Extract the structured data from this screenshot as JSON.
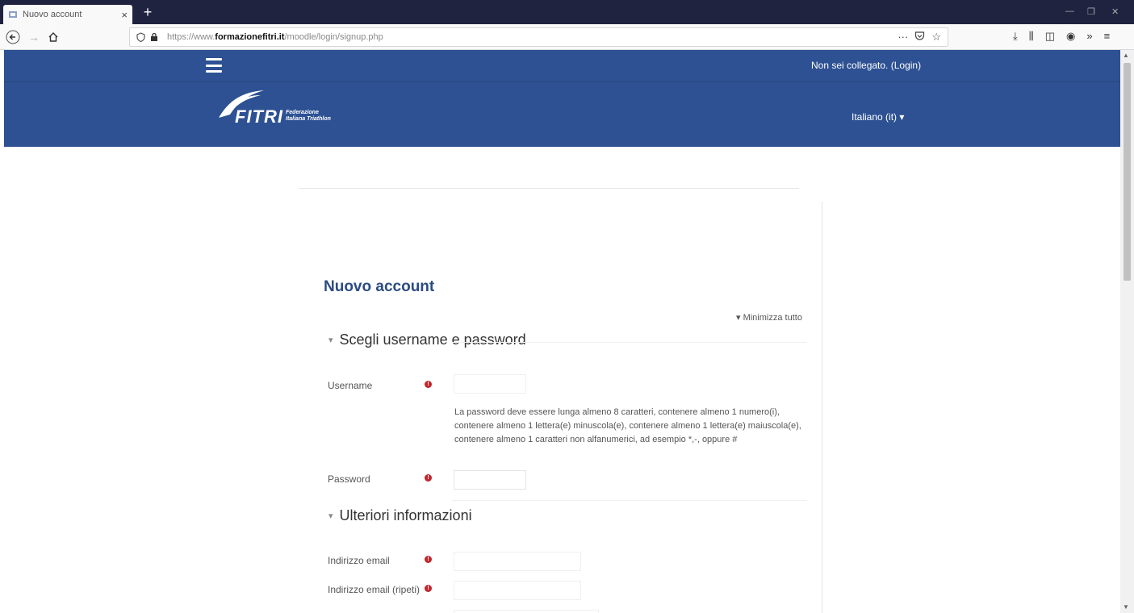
{
  "browser": {
    "tab_title": "Nuovo account",
    "tab_close": "×",
    "new_tab": "+",
    "url_prefix": "https://www.",
    "url_host": "formazionefitri.it",
    "url_path": "/moodle/login/signup.php",
    "url_more": "···"
  },
  "header": {
    "login_text": "Non sei collegato. (Login)",
    "language": "Italiano (it) ▾"
  },
  "logo": {
    "brand": "FITRI",
    "line1": "Federazione",
    "line2": "Italiana Triathlon"
  },
  "page": {
    "title": "Nuovo account",
    "collapse_all": "▾ Minimizza tutto"
  },
  "sections": {
    "account": {
      "caret": "▾",
      "title": "Scegli username e password"
    },
    "more": {
      "caret": "▾",
      "title": "Ulteriori informazioni"
    }
  },
  "fields": {
    "username_label": "Username",
    "password_help": "La password deve essere lunga almeno 8 caratteri, contenere almeno 1 numero(i), contenere almeno 1 lettera(e) minuscola(e), contenere almeno 1 lettera(e) maiuscola(e), contenere almeno 1 caratteri non alfanumerici, ad esempio *,-, oppure #",
    "password_label": "Password",
    "email_label": "Indirizzo email",
    "email_repeat_label": "Indirizzo email (ripeti)"
  },
  "icons": {
    "required": "required-icon",
    "hamburger": "menu-icon",
    "lock": "lock-icon",
    "shield": "shield-icon"
  },
  "colors": {
    "header_blue": "#2d5193",
    "title_blue": "#2b4c82",
    "required_red": "#c1272d"
  }
}
